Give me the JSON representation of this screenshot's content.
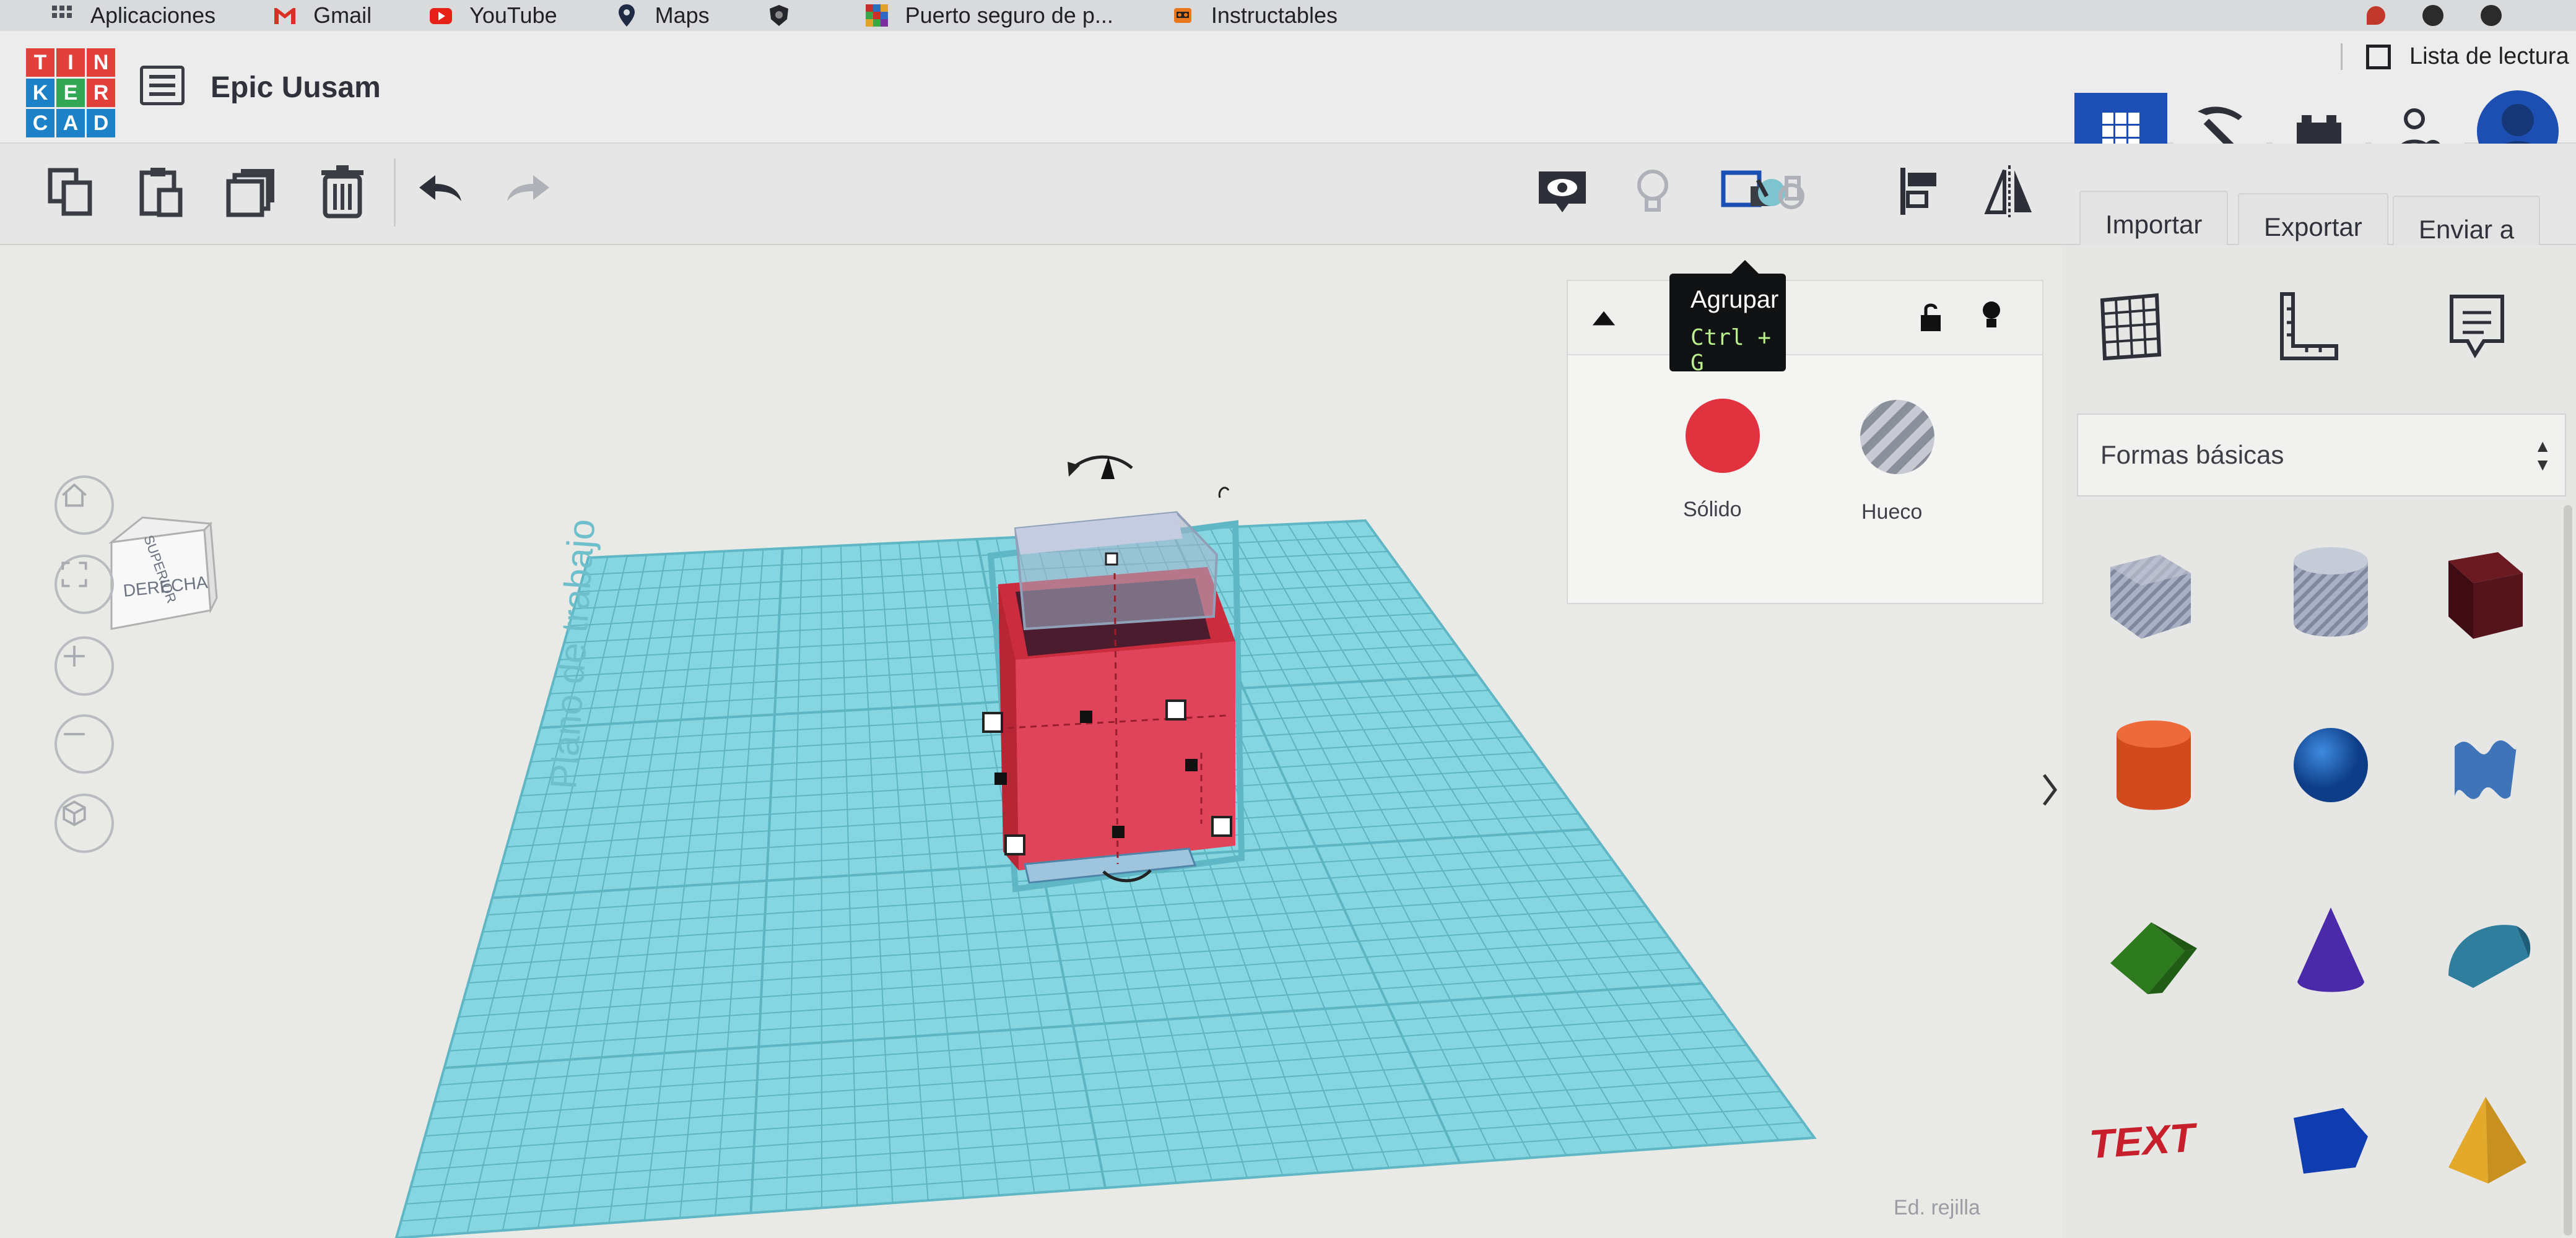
{
  "bookmarks": [
    {
      "label": "Aplicaciones",
      "icon": "apps-grid-icon"
    },
    {
      "label": "Gmail",
      "icon": "gmail-icon"
    },
    {
      "label": "YouTube",
      "icon": "youtube-icon"
    },
    {
      "label": "Maps",
      "icon": "maps-pin-icon"
    },
    {
      "label": "",
      "icon": "shield-icon"
    },
    {
      "label": "Puerto seguro de p...",
      "icon": "colorful-grid-icon"
    },
    {
      "label": "Instructables",
      "icon": "robot-icon"
    }
  ],
  "reading_list": "Lista de lectura",
  "design_title": "Epic Uusam",
  "logo_letters": [
    "T",
    "I",
    "N",
    "K",
    "E",
    "R",
    "C",
    "A",
    "D"
  ],
  "toolbar": {
    "import": "Importar",
    "export": "Exportar",
    "send": "Enviar a"
  },
  "tooltip": {
    "title": "Agrupar",
    "shortcut": "Ctrl + G"
  },
  "inspector": {
    "solid_label": "Sólido",
    "hole_label": "Hueco",
    "solid_color": "#e0323f"
  },
  "viewcube": {
    "top": "SUPERIOR",
    "right": "DERECHA"
  },
  "workplane_label": "Plano de trabajo",
  "shapes": {
    "category": "Formas básicas",
    "items": [
      "box-hole",
      "cylinder-hole",
      "box",
      "cylinder",
      "sphere",
      "scribble",
      "roof",
      "cone",
      "round-roof",
      "text",
      "polygon",
      "pyramid"
    ]
  },
  "grid_edit": "Ed. rejilla",
  "colors": {
    "accent_blue": "#1b4fb6",
    "workplane": "#7fd4e0",
    "object_red": "#e0323f"
  }
}
